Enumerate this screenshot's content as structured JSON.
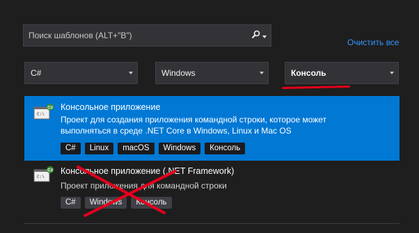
{
  "search": {
    "placeholder": "Поиск шаблонов (ALT+\"В\")"
  },
  "clear_all": "Очистить все",
  "filters": {
    "language": "C#",
    "platform": "Windows",
    "project_type": "Консоль"
  },
  "templates": [
    {
      "title": "Консольное приложение",
      "description_line1": "Проект для создания приложения командной строки, которое может",
      "description_line2": "выполняться в среде .NET Core в Windows, Linux и Mac OS",
      "tags": [
        "C#",
        "Linux",
        "macOS",
        "Windows",
        "Консоль"
      ],
      "selected": true
    },
    {
      "title": "Консольное приложение (.NET Framework)",
      "description_line1": "Проект приложения для командной строки",
      "tags": [
        "C#",
        "Windows",
        "Консоль"
      ],
      "selected": false
    }
  ],
  "icon_badge": "C#",
  "icon_prompt": "C:\\",
  "colors": {
    "background": "#1e1e1e",
    "selected": "#0078d4",
    "link": "#3794ff",
    "annotation_red": "#e3001b"
  }
}
